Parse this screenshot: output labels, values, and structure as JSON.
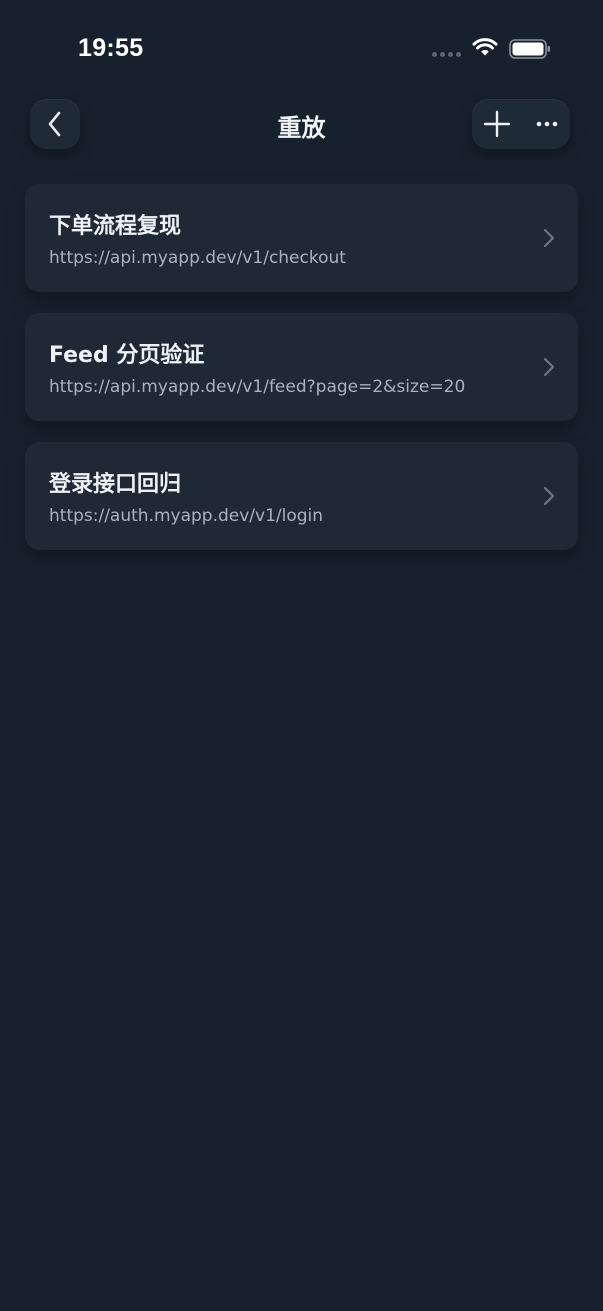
{
  "status_bar": {
    "time": "19:55",
    "signal_icon": "cellular-signal-icon",
    "wifi_icon": "wifi-icon",
    "battery_icon": "battery-icon"
  },
  "nav": {
    "title": "重放",
    "back_icon": "chevron-left-icon",
    "add_icon": "plus-icon",
    "more_icon": "ellipsis-icon"
  },
  "replays": [
    {
      "title": "下单流程复现",
      "url": "https://api.myapp.dev/v1/checkout"
    },
    {
      "title": "Feed 分页验证",
      "url": "https://api.myapp.dev/v1/feed?page=2&size=20"
    },
    {
      "title": "登录接口回归",
      "url": "https://auth.myapp.dev/v1/login"
    }
  ],
  "colors": {
    "background": "#17212d",
    "card": "#1e2935",
    "title_text": "#eef1f5",
    "secondary_text": "#a9b2bd",
    "chevron": "#6c7682"
  }
}
